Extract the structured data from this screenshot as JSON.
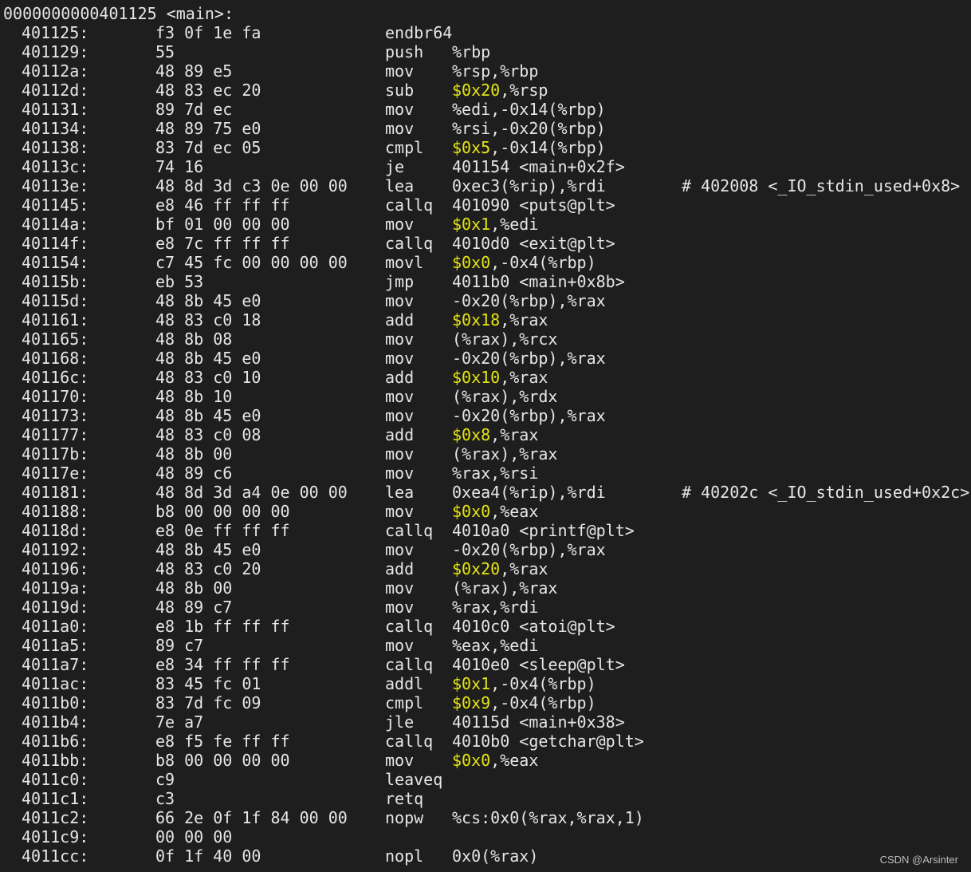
{
  "function_header": "0000000000401125 <main>:",
  "rows": [
    {
      "addr": "401125:",
      "bytes": "f3 0f 1e fa",
      "mnemonic": "endbr64",
      "imm": "",
      "rest": "",
      "comment": ""
    },
    {
      "addr": "401129:",
      "bytes": "55",
      "mnemonic": "push",
      "imm": "",
      "rest": "%rbp",
      "comment": ""
    },
    {
      "addr": "40112a:",
      "bytes": "48 89 e5",
      "mnemonic": "mov",
      "imm": "",
      "rest": "%rsp,%rbp",
      "comment": ""
    },
    {
      "addr": "40112d:",
      "bytes": "48 83 ec 20",
      "mnemonic": "sub",
      "imm": "$0x20",
      "rest": ",%rsp",
      "comment": ""
    },
    {
      "addr": "401131:",
      "bytes": "89 7d ec",
      "mnemonic": "mov",
      "imm": "",
      "rest": "%edi,-0x14(%rbp)",
      "comment": ""
    },
    {
      "addr": "401134:",
      "bytes": "48 89 75 e0",
      "mnemonic": "mov",
      "imm": "",
      "rest": "%rsi,-0x20(%rbp)",
      "comment": ""
    },
    {
      "addr": "401138:",
      "bytes": "83 7d ec 05",
      "mnemonic": "cmpl",
      "imm": "$0x5",
      "rest": ",-0x14(%rbp)",
      "comment": ""
    },
    {
      "addr": "40113c:",
      "bytes": "74 16",
      "mnemonic": "je",
      "imm": "",
      "rest": "401154 <main+0x2f>",
      "comment": ""
    },
    {
      "addr": "40113e:",
      "bytes": "48 8d 3d c3 0e 00 00",
      "mnemonic": "lea",
      "imm": "",
      "rest": "0xec3(%rip),%rdi",
      "comment": "# 402008 <_IO_stdin_used+0x8>"
    },
    {
      "addr": "401145:",
      "bytes": "e8 46 ff ff ff",
      "mnemonic": "callq",
      "imm": "",
      "rest": "401090 <puts@plt>",
      "comment": ""
    },
    {
      "addr": "40114a:",
      "bytes": "bf 01 00 00 00",
      "mnemonic": "mov",
      "imm": "$0x1",
      "rest": ",%edi",
      "comment": ""
    },
    {
      "addr": "40114f:",
      "bytes": "e8 7c ff ff ff",
      "mnemonic": "callq",
      "imm": "",
      "rest": "4010d0 <exit@plt>",
      "comment": ""
    },
    {
      "addr": "401154:",
      "bytes": "c7 45 fc 00 00 00 00",
      "mnemonic": "movl",
      "imm": "$0x0",
      "rest": ",-0x4(%rbp)",
      "comment": ""
    },
    {
      "addr": "40115b:",
      "bytes": "eb 53",
      "mnemonic": "jmp",
      "imm": "",
      "rest": "4011b0 <main+0x8b>",
      "comment": ""
    },
    {
      "addr": "40115d:",
      "bytes": "48 8b 45 e0",
      "mnemonic": "mov",
      "imm": "",
      "rest": "-0x20(%rbp),%rax",
      "comment": ""
    },
    {
      "addr": "401161:",
      "bytes": "48 83 c0 18",
      "mnemonic": "add",
      "imm": "$0x18",
      "rest": ",%rax",
      "comment": ""
    },
    {
      "addr": "401165:",
      "bytes": "48 8b 08",
      "mnemonic": "mov",
      "imm": "",
      "rest": "(%rax),%rcx",
      "comment": ""
    },
    {
      "addr": "401168:",
      "bytes": "48 8b 45 e0",
      "mnemonic": "mov",
      "imm": "",
      "rest": "-0x20(%rbp),%rax",
      "comment": ""
    },
    {
      "addr": "40116c:",
      "bytes": "48 83 c0 10",
      "mnemonic": "add",
      "imm": "$0x10",
      "rest": ",%rax",
      "comment": ""
    },
    {
      "addr": "401170:",
      "bytes": "48 8b 10",
      "mnemonic": "mov",
      "imm": "",
      "rest": "(%rax),%rdx",
      "comment": ""
    },
    {
      "addr": "401173:",
      "bytes": "48 8b 45 e0",
      "mnemonic": "mov",
      "imm": "",
      "rest": "-0x20(%rbp),%rax",
      "comment": ""
    },
    {
      "addr": "401177:",
      "bytes": "48 83 c0 08",
      "mnemonic": "add",
      "imm": "$0x8",
      "rest": ",%rax",
      "comment": ""
    },
    {
      "addr": "40117b:",
      "bytes": "48 8b 00",
      "mnemonic": "mov",
      "imm": "",
      "rest": "(%rax),%rax",
      "comment": ""
    },
    {
      "addr": "40117e:",
      "bytes": "48 89 c6",
      "mnemonic": "mov",
      "imm": "",
      "rest": "%rax,%rsi",
      "comment": ""
    },
    {
      "addr": "401181:",
      "bytes": "48 8d 3d a4 0e 00 00",
      "mnemonic": "lea",
      "imm": "",
      "rest": "0xea4(%rip),%rdi",
      "comment": "# 40202c <_IO_stdin_used+0x2c>"
    },
    {
      "addr": "401188:",
      "bytes": "b8 00 00 00 00",
      "mnemonic": "mov",
      "imm": "$0x0",
      "rest": ",%eax",
      "comment": ""
    },
    {
      "addr": "40118d:",
      "bytes": "e8 0e ff ff ff",
      "mnemonic": "callq",
      "imm": "",
      "rest": "4010a0 <printf@plt>",
      "comment": ""
    },
    {
      "addr": "401192:",
      "bytes": "48 8b 45 e0",
      "mnemonic": "mov",
      "imm": "",
      "rest": "-0x20(%rbp),%rax",
      "comment": ""
    },
    {
      "addr": "401196:",
      "bytes": "48 83 c0 20",
      "mnemonic": "add",
      "imm": "$0x20",
      "rest": ",%rax",
      "comment": ""
    },
    {
      "addr": "40119a:",
      "bytes": "48 8b 00",
      "mnemonic": "mov",
      "imm": "",
      "rest": "(%rax),%rax",
      "comment": ""
    },
    {
      "addr": "40119d:",
      "bytes": "48 89 c7",
      "mnemonic": "mov",
      "imm": "",
      "rest": "%rax,%rdi",
      "comment": ""
    },
    {
      "addr": "4011a0:",
      "bytes": "e8 1b ff ff ff",
      "mnemonic": "callq",
      "imm": "",
      "rest": "4010c0 <atoi@plt>",
      "comment": ""
    },
    {
      "addr": "4011a5:",
      "bytes": "89 c7",
      "mnemonic": "mov",
      "imm": "",
      "rest": "%eax,%edi",
      "comment": ""
    },
    {
      "addr": "4011a7:",
      "bytes": "e8 34 ff ff ff",
      "mnemonic": "callq",
      "imm": "",
      "rest": "4010e0 <sleep@plt>",
      "comment": ""
    },
    {
      "addr": "4011ac:",
      "bytes": "83 45 fc 01",
      "mnemonic": "addl",
      "imm": "$0x1",
      "rest": ",-0x4(%rbp)",
      "comment": ""
    },
    {
      "addr": "4011b0:",
      "bytes": "83 7d fc 09",
      "mnemonic": "cmpl",
      "imm": "$0x9",
      "rest": ",-0x4(%rbp)",
      "comment": ""
    },
    {
      "addr": "4011b4:",
      "bytes": "7e a7",
      "mnemonic": "jle",
      "imm": "",
      "rest": "40115d <main+0x38>",
      "comment": ""
    },
    {
      "addr": "4011b6:",
      "bytes": "e8 f5 fe ff ff",
      "mnemonic": "callq",
      "imm": "",
      "rest": "4010b0 <getchar@plt>",
      "comment": ""
    },
    {
      "addr": "4011bb:",
      "bytes": "b8 00 00 00 00",
      "mnemonic": "mov",
      "imm": "$0x0",
      "rest": ",%eax",
      "comment": ""
    },
    {
      "addr": "4011c0:",
      "bytes": "c9",
      "mnemonic": "leaveq",
      "imm": "",
      "rest": "",
      "comment": ""
    },
    {
      "addr": "4011c1:",
      "bytes": "c3",
      "mnemonic": "retq",
      "imm": "",
      "rest": "",
      "comment": ""
    },
    {
      "addr": "4011c2:",
      "bytes": "66 2e 0f 1f 84 00 00",
      "mnemonic": "nopw",
      "imm": "",
      "rest": "%cs:0x0(%rax,%rax,1)",
      "comment": ""
    },
    {
      "addr": "4011c9:",
      "bytes": "00 00 00",
      "mnemonic": "",
      "imm": "",
      "rest": "",
      "comment": ""
    },
    {
      "addr": "4011cc:",
      "bytes": "0f 1f 40 00",
      "mnemonic": "nopl",
      "imm": "",
      "rest": "0x0(%rax)",
      "comment": ""
    }
  ],
  "watermark": "CSDN @Arsinter",
  "colors": {
    "background": "#1e1e1e",
    "text": "#e6e6e6",
    "immediate": "#e5e510"
  }
}
